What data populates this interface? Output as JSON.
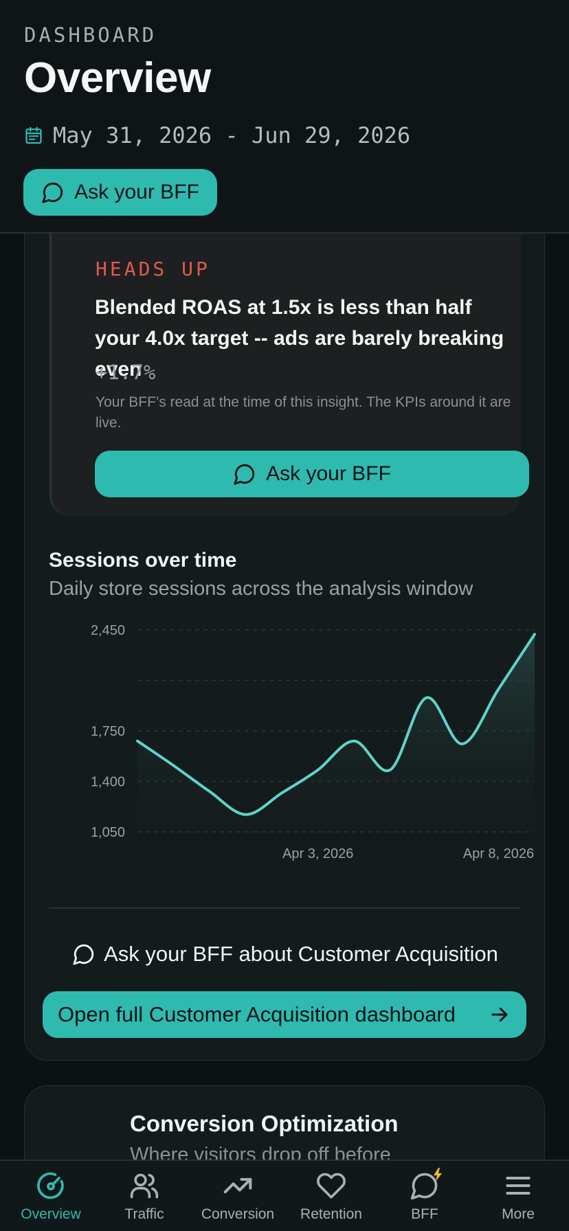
{
  "header": {
    "eyebrow": "DASHBOARD",
    "title": "Overview",
    "date_range": "May 31, 2026 - Jun 29, 2026",
    "ask_button": "Ask your BFF"
  },
  "alert": {
    "label": "HEADS UP",
    "title": "Blended ROAS at 1.5x is less than half your 4.0x target -- ads are barely breaking even",
    "delta": "+1.7%",
    "note": "Your BFF’s read at the time of this insight. The KPIs around it are live.",
    "ask_button": "Ask your BFF"
  },
  "chart": {
    "title": "Sessions over time",
    "subtitle": "Daily store sessions across the analysis window"
  },
  "chart_data": {
    "type": "area",
    "title": "Sessions over time",
    "subtitle": "Daily store sessions across the analysis window",
    "x": [
      "Mar 29, 2026",
      "Mar 30, 2026",
      "Mar 31, 2026",
      "Apr 1, 2026",
      "Apr 2, 2026",
      "Apr 3, 2026",
      "Apr 4, 2026",
      "Apr 5, 2026",
      "Apr 6, 2026",
      "Apr 7, 2026",
      "Apr 8, 2026",
      "Apr 9, 2026"
    ],
    "x_tick_labels": [
      "Apr 3, 2026",
      "Apr 8, 2026"
    ],
    "values": [
      1680,
      1510,
      1330,
      1170,
      1320,
      1480,
      1680,
      1480,
      1980,
      1660,
      2040,
      2420
    ],
    "y_ticks": [
      1050,
      1400,
      1750,
      2450
    ],
    "y_tick_labels": [
      "1,050",
      "1,400",
      "1,750",
      "2,450"
    ],
    "ylim": [
      1050,
      2450
    ],
    "grid": true,
    "color": "#5fd3c8"
  },
  "section": {
    "ask_topic": "Ask your BFF about Customer Acquisition",
    "open_dashboard": "Open full Customer Acquisition dashboard"
  },
  "conversion": {
    "title": "Conversion Optimization",
    "subtitle": "Where visitors drop off before"
  },
  "nav": [
    {
      "label": "Overview",
      "icon": "gauge-icon",
      "active": true
    },
    {
      "label": "Traffic",
      "icon": "users-icon",
      "active": false
    },
    {
      "label": "Conversion",
      "icon": "trend-up-icon",
      "active": false
    },
    {
      "label": "Retention",
      "icon": "heart-icon",
      "active": false
    },
    {
      "label": "BFF",
      "icon": "chat-bolt-icon",
      "active": false
    },
    {
      "label": "More",
      "icon": "menu-icon",
      "active": false
    }
  ],
  "colors": {
    "accent": "#2fbab0",
    "alert": "#e05a4f",
    "background": "#0c1213",
    "line": "#5fd3c8"
  }
}
